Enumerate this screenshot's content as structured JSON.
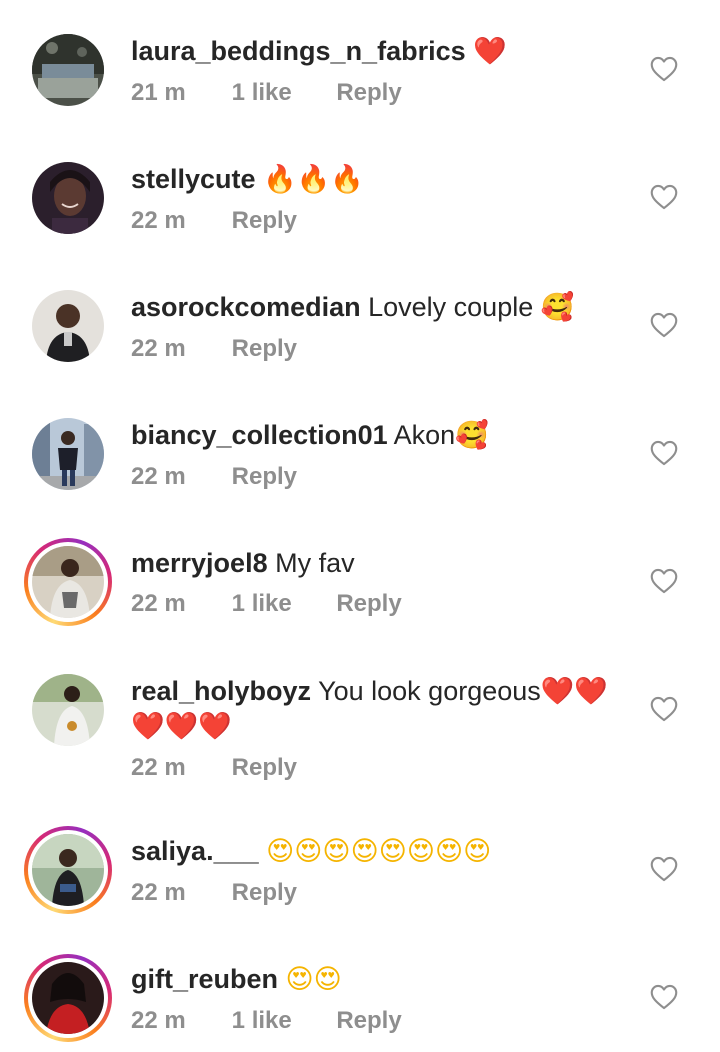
{
  "comments": [
    {
      "username": "laura_beddings_n_fabrics",
      "text": "",
      "emoji": "❤️",
      "time": "21 m",
      "likes": "1 like",
      "reply": "Reply",
      "avatar_color": "#5a5f57"
    },
    {
      "username": "stellycute",
      "text": "",
      "emoji": "🔥🔥🔥",
      "time": "22 m",
      "likes": "",
      "reply": "Reply",
      "avatar_color": "#3a2a3a"
    },
    {
      "username": "asorockcomedian",
      "text": "Lovely couple",
      "emoji": "🥰",
      "time": "22 m",
      "likes": "",
      "reply": "Reply",
      "avatar_color": "#d9d6d0"
    },
    {
      "username": "biancy_collection01",
      "text": "Akon",
      "emoji": "🥰",
      "time": "22 m",
      "likes": "",
      "reply": "Reply",
      "avatar_color": "#8fa0b5"
    },
    {
      "username": "merryjoel8",
      "text": "My fav",
      "emoji": "",
      "time": "22 m",
      "likes": "1 like",
      "reply": "Reply",
      "avatar_color": "#c9c2b5"
    },
    {
      "username": "real_holyboyz",
      "text": "You look gorgeous",
      "emoji": "❤️❤️",
      "emoji_line2": "❤️❤️❤️",
      "time": "22 m",
      "likes": "",
      "reply": "Reply",
      "avatar_color": "#c7cfbf"
    },
    {
      "username": "saliya.___",
      "text": "",
      "emoji": "😍😍😍😍😍😍😍😍",
      "time": "22 m",
      "likes": "",
      "reply": "Reply",
      "avatar_color": "#7e9a7a"
    },
    {
      "username": "gift_reuben",
      "text": "",
      "emoji": "😍😍",
      "time": "22 m",
      "likes": "1 like",
      "reply": "Reply",
      "avatar_color": "#7a1b1b"
    }
  ],
  "colors": {
    "text": "#262626",
    "meta": "#8e8e8e",
    "heart_outline": "#8e8e8e",
    "story_ring": "#d62976"
  },
  "icons": {
    "like": "heart-outline-icon"
  }
}
